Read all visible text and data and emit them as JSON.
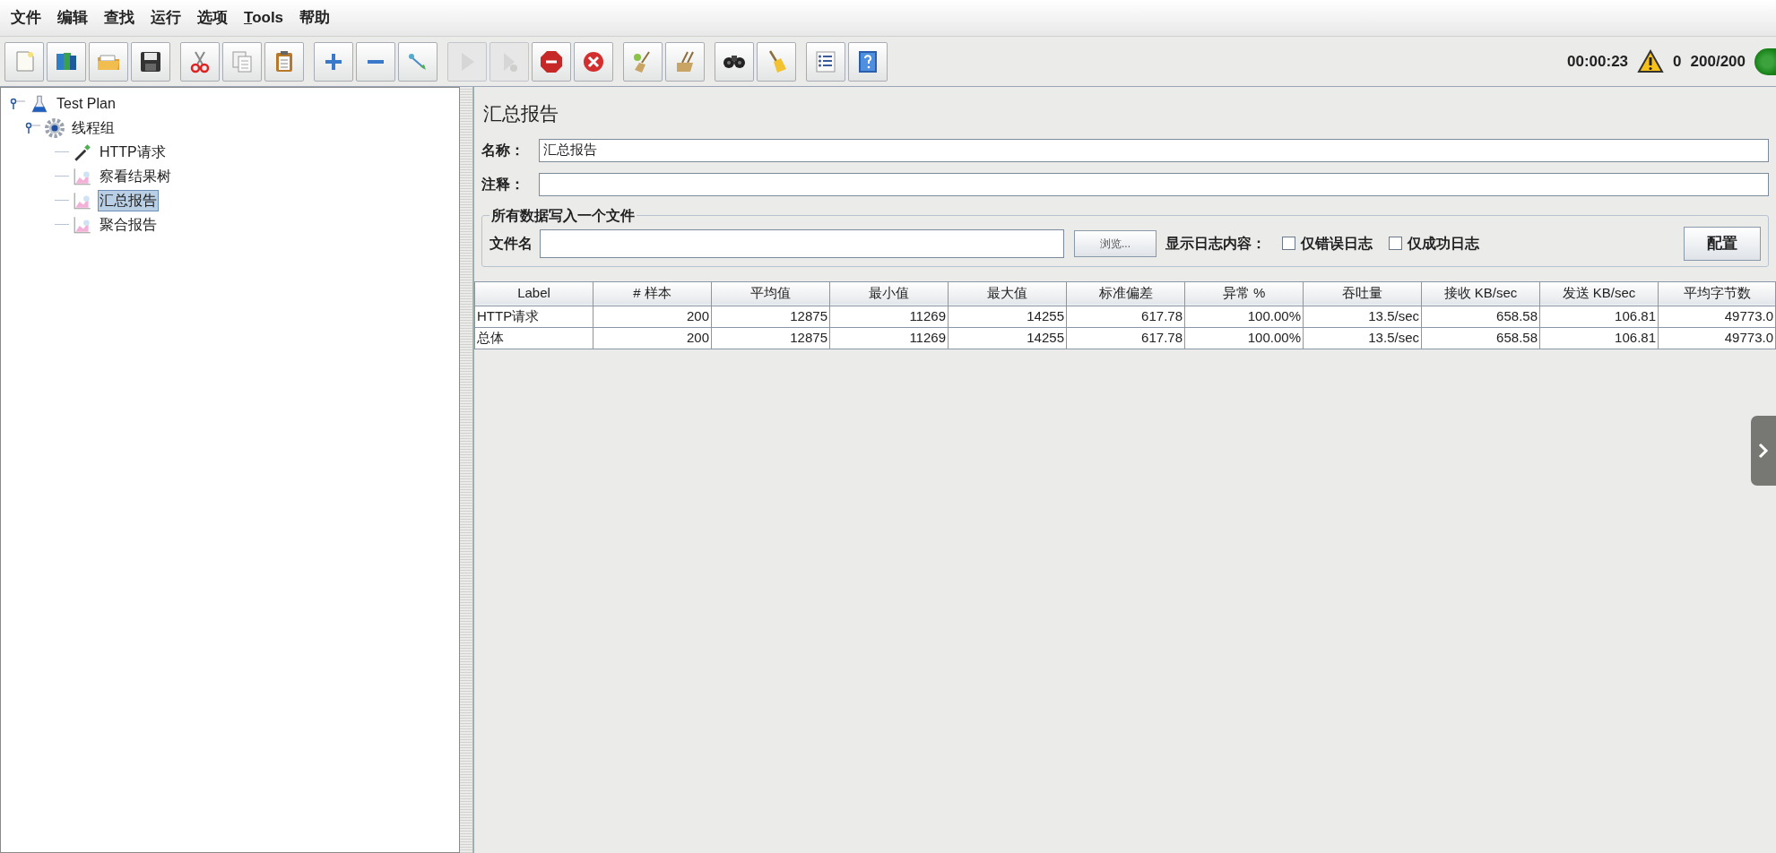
{
  "menu": [
    {
      "label": "文件",
      "underline_first": false
    },
    {
      "label": "编辑",
      "underline_first": false
    },
    {
      "label": "查找",
      "underline_first": false
    },
    {
      "label": "运行",
      "underline_first": false
    },
    {
      "label": "选项",
      "underline_first": false
    },
    {
      "label": "Tools",
      "underline_first": true
    },
    {
      "label": "帮助",
      "underline_first": false
    }
  ],
  "toolbar": [
    [
      {
        "kind": "new",
        "disabled": false
      },
      {
        "kind": "templates",
        "disabled": false
      },
      {
        "kind": "open",
        "disabled": false
      },
      {
        "kind": "save",
        "disabled": false
      }
    ],
    [
      {
        "kind": "cut",
        "disabled": false
      },
      {
        "kind": "copy",
        "disabled": false
      },
      {
        "kind": "paste",
        "disabled": false
      }
    ],
    [
      {
        "kind": "expand",
        "disabled": false
      },
      {
        "kind": "collapse",
        "disabled": false
      },
      {
        "kind": "toggle",
        "disabled": false
      }
    ],
    [
      {
        "kind": "start",
        "disabled": true
      },
      {
        "kind": "start-no-pause",
        "disabled": true
      },
      {
        "kind": "stop",
        "disabled": false
      },
      {
        "kind": "shutdown",
        "disabled": false
      }
    ],
    [
      {
        "kind": "clear",
        "disabled": false
      },
      {
        "kind": "clear-all",
        "disabled": false
      }
    ],
    [
      {
        "kind": "search",
        "disabled": false
      },
      {
        "kind": "reset-search",
        "disabled": false
      }
    ],
    [
      {
        "kind": "functions",
        "disabled": false
      },
      {
        "kind": "help",
        "disabled": false
      }
    ]
  ],
  "status": {
    "elapsed": "00:00:23",
    "warnings": "0",
    "threads": "200/200",
    "running": true
  },
  "tree": [
    {
      "label": "Test Plan",
      "kind": "plan",
      "selected": false,
      "children": [
        {
          "label": "线程组",
          "kind": "thread-group",
          "selected": false,
          "children": [
            {
              "label": "HTTP请求",
              "kind": "sampler",
              "selected": false
            },
            {
              "label": "察看结果树",
              "kind": "listener",
              "selected": false
            },
            {
              "label": "汇总报告",
              "kind": "listener",
              "selected": true
            },
            {
              "label": "聚合报告",
              "kind": "listener",
              "selected": false
            }
          ]
        }
      ]
    }
  ],
  "panel": {
    "title": "汇总报告",
    "name_label": "名称：",
    "name_value": "汇总报告",
    "comment_label": "注释：",
    "file_section": {
      "legend": "所有数据写入一个文件",
      "filename_label": "文件名",
      "browse_button": "浏览...",
      "log_label": "显示日志内容：",
      "checkboxes": [
        {
          "label": "仅错误日志",
          "checked": false
        },
        {
          "label": "仅成功日志",
          "checked": false
        }
      ],
      "config_button": "配置"
    }
  },
  "table": {
    "columns": [
      "Label",
      "# 样本",
      "平均值",
      "最小值",
      "最大值",
      "标准偏差",
      "异常 %",
      "吞吐量",
      "接收 KB/sec",
      "发送 KB/sec",
      "平均字节数"
    ],
    "rows": [
      [
        "HTTP请求",
        "200",
        "12875",
        "11269",
        "14255",
        "617.78",
        "100.00%",
        "13.5/sec",
        "658.58",
        "106.81",
        "49773.0"
      ],
      [
        "总体",
        "200",
        "12875",
        "11269",
        "14255",
        "617.78",
        "100.00%",
        "13.5/sec",
        "658.58",
        "106.81",
        "49773.0"
      ]
    ]
  }
}
